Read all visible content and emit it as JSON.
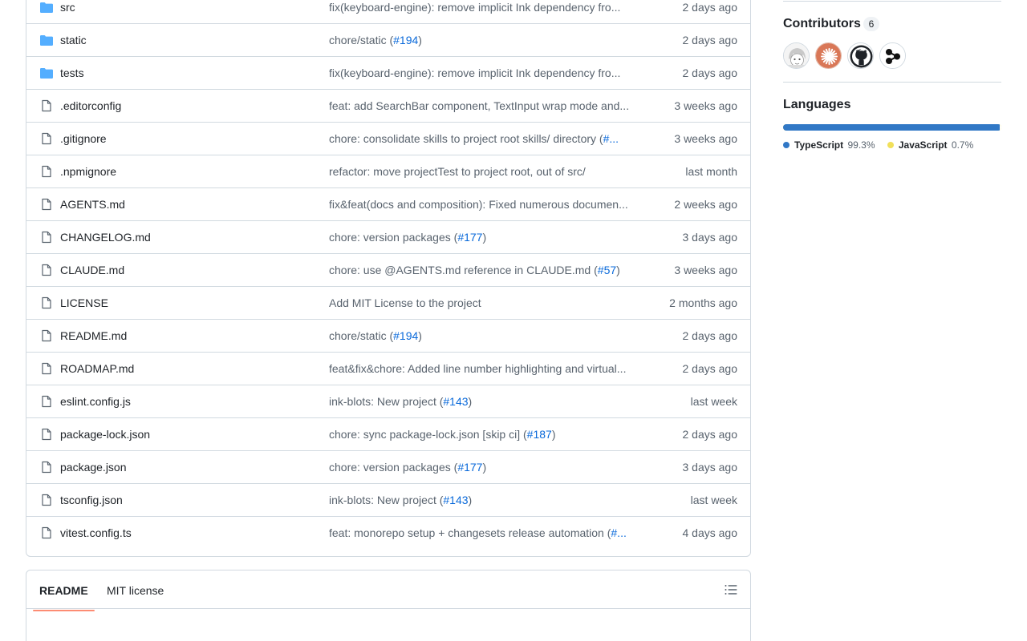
{
  "files": [
    {
      "type": "dir",
      "name": "src",
      "message": "fix(keyboard-engine): remove implicit Ink dependency fro...",
      "pr": "",
      "tail": "",
      "date": "2 days ago"
    },
    {
      "type": "dir",
      "name": "static",
      "message": "chore/static (",
      "pr": "#194",
      "tail": ")",
      "date": "2 days ago"
    },
    {
      "type": "dir",
      "name": "tests",
      "message": "fix(keyboard-engine): remove implicit Ink dependency fro...",
      "pr": "",
      "tail": "",
      "date": "2 days ago"
    },
    {
      "type": "file",
      "name": ".editorconfig",
      "message": "feat: add SearchBar component, TextInput wrap mode and...",
      "pr": "",
      "tail": "",
      "date": "3 weeks ago"
    },
    {
      "type": "file",
      "name": ".gitignore",
      "message": "chore: consolidate skills to project root skills/ directory (",
      "pr": "#...",
      "tail": "",
      "date": "3 weeks ago"
    },
    {
      "type": "file",
      "name": ".npmignore",
      "message": "refactor: move projectTest to project root, out of src/",
      "pr": "",
      "tail": "",
      "date": "last month"
    },
    {
      "type": "file",
      "name": "AGENTS.md",
      "message": "fix&feat(docs and composition): Fixed numerous documen...",
      "pr": "",
      "tail": "",
      "date": "2 weeks ago"
    },
    {
      "type": "file",
      "name": "CHANGELOG.md",
      "message": "chore: version packages (",
      "pr": "#177",
      "tail": ")",
      "date": "3 days ago"
    },
    {
      "type": "file",
      "name": "CLAUDE.md",
      "message": "chore: use @AGENTS.md reference in CLAUDE.md (",
      "pr": "#57",
      "tail": ")",
      "date": "3 weeks ago"
    },
    {
      "type": "file",
      "name": "LICENSE",
      "message": "Add MIT License to the project",
      "pr": "",
      "tail": "",
      "date": "2 months ago"
    },
    {
      "type": "file",
      "name": "README.md",
      "message": "chore/static (",
      "pr": "#194",
      "tail": ")",
      "date": "2 days ago"
    },
    {
      "type": "file",
      "name": "ROADMAP.md",
      "message": "feat&fix&chore: Added line number highlighting and virtual...",
      "pr": "",
      "tail": "",
      "date": "2 days ago"
    },
    {
      "type": "file",
      "name": "eslint.config.js",
      "message": "ink-blots: New project (",
      "pr": "#143",
      "tail": ")",
      "date": "last week"
    },
    {
      "type": "file",
      "name": "package-lock.json",
      "message": "chore: sync package-lock.json [skip ci] (",
      "pr": "#187",
      "tail": ")",
      "date": "2 days ago"
    },
    {
      "type": "file",
      "name": "package.json",
      "message": "chore: version packages (",
      "pr": "#177",
      "tail": ")",
      "date": "3 days ago"
    },
    {
      "type": "file",
      "name": "tsconfig.json",
      "message": "ink-blots: New project (",
      "pr": "#143",
      "tail": ")",
      "date": "last week"
    },
    {
      "type": "file",
      "name": "vitest.config.ts",
      "message": "feat: monorepo setup + changesets release automation (",
      "pr": "#...",
      "tail": "",
      "date": "4 days ago"
    }
  ],
  "readme": {
    "tabs": [
      {
        "label": "README",
        "active": true
      },
      {
        "label": "MIT license",
        "active": false
      }
    ],
    "toc_icon": "list-unordered-icon"
  },
  "sidebar": {
    "contributors": {
      "heading": "Contributors",
      "count": "6",
      "avatars": [
        "anime-avatar",
        "orange-burst-avatar",
        "github-octocat-avatar",
        "molecule-avatar"
      ]
    },
    "languages": {
      "heading": "Languages",
      "items": [
        {
          "name": "TypeScript",
          "percent": "99.3%",
          "fraction": 0.993,
          "color": "#3178c6"
        },
        {
          "name": "JavaScript",
          "percent": "0.7%",
          "fraction": 0.007,
          "color": "#f1e05a"
        }
      ]
    }
  },
  "colors": {
    "link": "#0969da",
    "folder": "#54aeff",
    "border": "#d1d9e0",
    "tab_underline": "#fd8c73"
  }
}
